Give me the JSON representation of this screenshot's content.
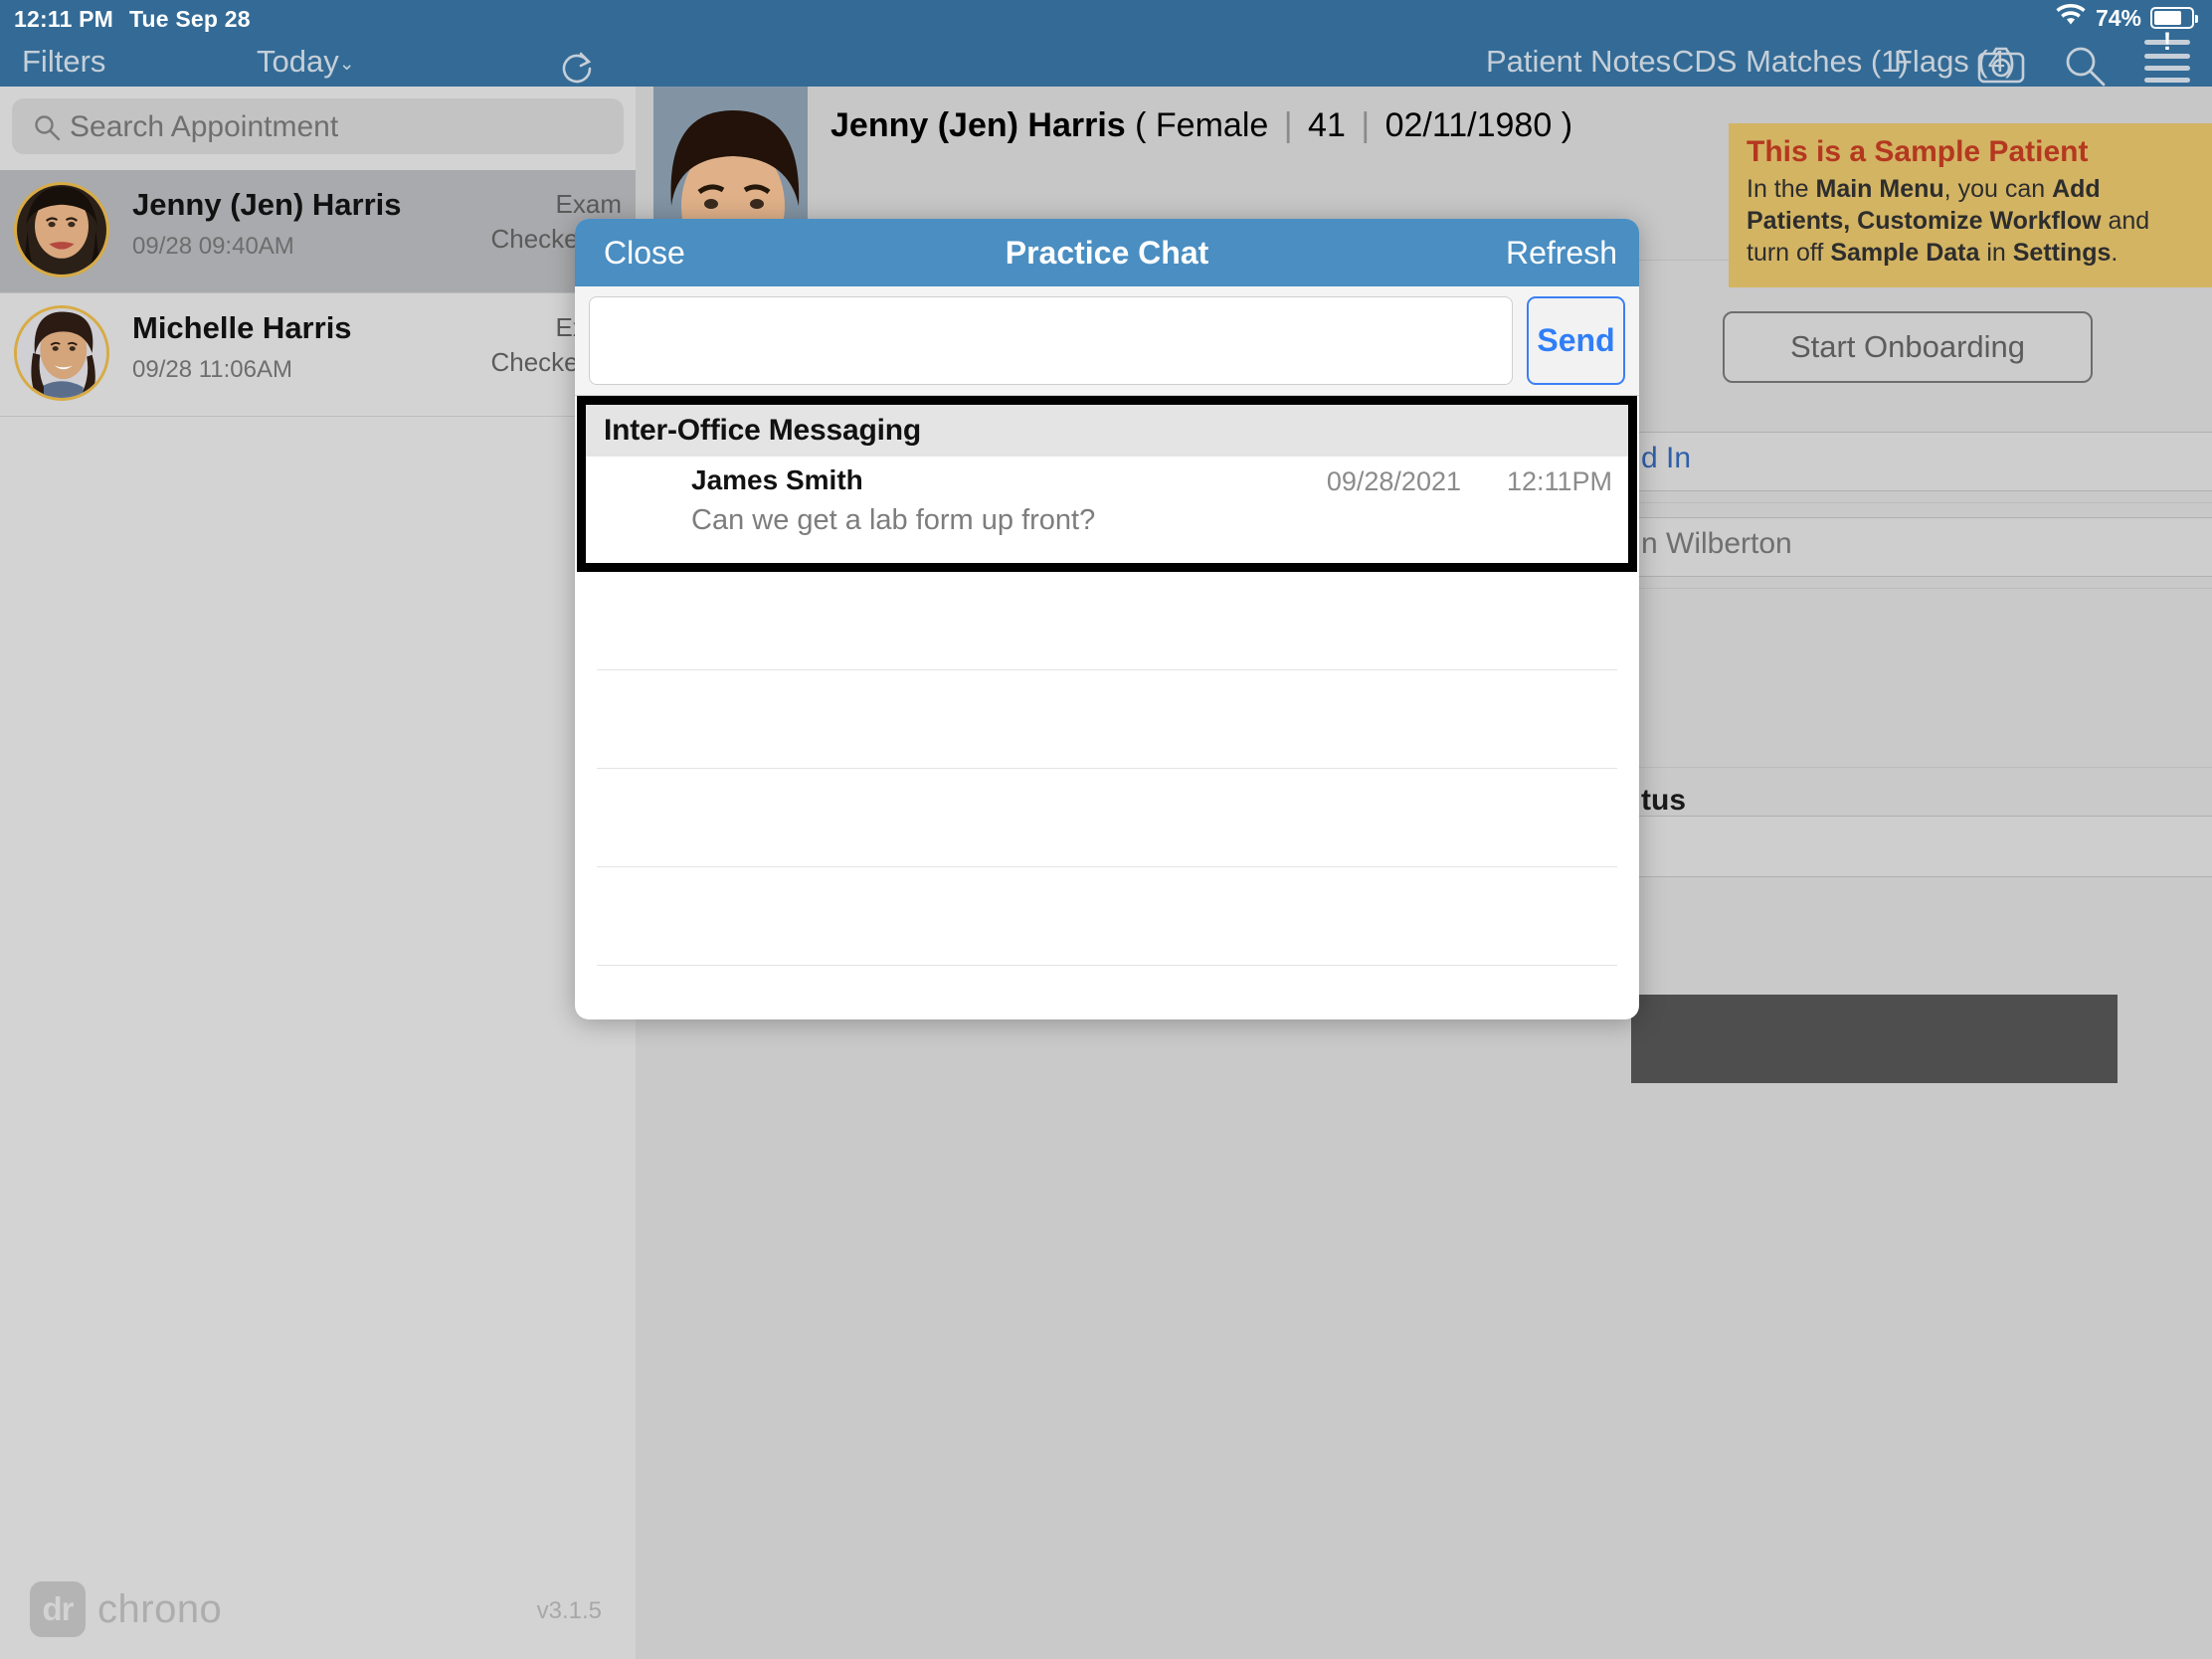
{
  "status_bar": {
    "time": "12:11 PM",
    "date": "Tue Sep 28",
    "battery_percent": "74%",
    "wifi_icon": "wifi-icon",
    "battery_icon": "battery-icon"
  },
  "left_panel": {
    "nav": {
      "filters_label": "Filters",
      "today_label": "Today",
      "chevron": "⌄",
      "refresh_icon": "refresh-icon"
    },
    "search": {
      "placeholder": "Search Appointment",
      "value": "",
      "icon": "search-icon"
    },
    "appointments": [
      {
        "name": "Jenny (Jen) Harris",
        "time": "09/28 09:40AM",
        "status": "Exam\nChecked In",
        "status_line1": "Exam",
        "status_line2": "Checked In",
        "selected": true
      },
      {
        "name": "Michelle Harris",
        "time": "09/28 11:06AM",
        "status_line1": "Exam",
        "status_line2": "Checked In",
        "selected": false
      }
    ],
    "footer": {
      "brand_badge": "dr",
      "brand_name": "chrono",
      "version": "v3.1.5"
    }
  },
  "right_panel": {
    "tabs": [
      {
        "label": "Patient Notes"
      },
      {
        "label": "CDS Matches (1)"
      },
      {
        "label": "Flags (4)"
      }
    ],
    "nav_icons": {
      "camera": "camera-icon",
      "search": "search-icon",
      "menu": "hamburger-menu-icon",
      "alert_badge": "!"
    },
    "patient": {
      "name": "Jenny (Jen) Harris",
      "open_paren": "(",
      "gender": "Female",
      "age": "41",
      "dob": "02/11/1980",
      "close_paren": ")",
      "separator": "|"
    },
    "callout": {
      "title": "This is a Sample Patient",
      "line1_a": "In the ",
      "line1_b": "Main Menu",
      "line1_c": ", you can ",
      "line1_d": "Add",
      "line2_a": "Patients, Customize Workflow",
      "line2_b": " and",
      "line3_a": "turn off ",
      "line3_b": "Sample Data",
      "line3_c": " in ",
      "line3_d": "Settings",
      "line3_e": "."
    },
    "onboarding_button": "Start Onboarding",
    "fields": [
      {
        "name": "checked-in-field",
        "value": "d In"
      },
      {
        "name": "provider-field",
        "value": "n Wilberton"
      },
      {
        "name": "status-field-label",
        "value": "tus"
      }
    ]
  },
  "modal": {
    "close_label": "Close",
    "title": "Practice Chat",
    "refresh_label": "Refresh",
    "compose": {
      "value": "",
      "placeholder": ""
    },
    "send_label": "Send",
    "section_header": "Inter-Office Messaging",
    "messages": [
      {
        "author": "James Smith",
        "date": "09/28/2021",
        "time": "12:11PM",
        "body": "Can we get a lab form up front?"
      }
    ],
    "empty_rows": 5
  },
  "colors": {
    "nav_blue": "#336b96",
    "modal_blue": "#4a8ec2",
    "send_blue": "#2f7ef8",
    "callout_bg": "#d3b463",
    "callout_title": "#b4381f",
    "alert_red": "#cf2028",
    "avatar_ring": "#d8ab43"
  }
}
